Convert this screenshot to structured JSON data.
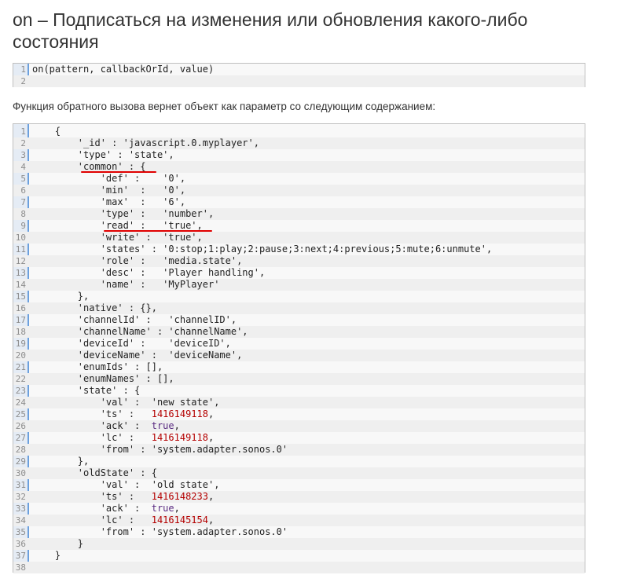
{
  "title": "on – Подписаться на изменения или обновления какого-либо состояния",
  "signature": {
    "lines": [
      [
        {
          "t": "on(pattern, callbackOrId, value)",
          "c": ""
        }
      ],
      []
    ]
  },
  "description": "Функция обратного вызова вернет объект как параметр со следующим содержанием:",
  "code": {
    "lines": [
      [
        {
          "t": "    {",
          "c": ""
        }
      ],
      [
        {
          "t": "        '_id' : 'javascript.0.myplayer',",
          "c": ""
        }
      ],
      [
        {
          "t": "        'type' : 'state',",
          "c": ""
        }
      ],
      [
        {
          "t": "        'common' : {",
          "c": ""
        }
      ],
      [
        {
          "t": "            'def' :    '0',",
          "c": ""
        }
      ],
      [
        {
          "t": "            'min'  :   '0',",
          "c": ""
        }
      ],
      [
        {
          "t": "            'max'  :   '6',",
          "c": ""
        }
      ],
      [
        {
          "t": "            'type' :   'number',",
          "c": ""
        }
      ],
      [
        {
          "t": "            'read' :   'true',",
          "c": ""
        }
      ],
      [
        {
          "t": "            'write' :  'true',",
          "c": ""
        }
      ],
      [
        {
          "t": "            'states' : '0:stop;1:play;2:pause;3:next;4:previous;5:mute;6:unmute',",
          "c": ""
        }
      ],
      [
        {
          "t": "            'role' :   'media.state',",
          "c": ""
        }
      ],
      [
        {
          "t": "            'desc' :   'Player handling',",
          "c": ""
        }
      ],
      [
        {
          "t": "            'name' :   'MyPlayer'",
          "c": ""
        }
      ],
      [
        {
          "t": "        },",
          "c": ""
        }
      ],
      [
        {
          "t": "        'native' : {},",
          "c": ""
        }
      ],
      [
        {
          "t": "        'channelId' :   'channelID',",
          "c": ""
        }
      ],
      [
        {
          "t": "        'channelName' : 'channelName',",
          "c": ""
        }
      ],
      [
        {
          "t": "        'deviceId' :    'deviceID',",
          "c": ""
        }
      ],
      [
        {
          "t": "        'deviceName' :  'deviceName',",
          "c": ""
        }
      ],
      [
        {
          "t": "        'enumIds' : [],",
          "c": ""
        }
      ],
      [
        {
          "t": "        'enumNames' : [],",
          "c": ""
        }
      ],
      [
        {
          "t": "        'state' : {",
          "c": ""
        }
      ],
      [
        {
          "t": "            'val' :  'new state',",
          "c": ""
        }
      ],
      [
        {
          "t": "            'ts' :   ",
          "c": ""
        },
        {
          "t": "1416149118",
          "c": "n"
        },
        {
          "t": ",",
          "c": ""
        }
      ],
      [
        {
          "t": "            'ack' :  ",
          "c": ""
        },
        {
          "t": "true",
          "c": "kw"
        },
        {
          "t": ",",
          "c": ""
        }
      ],
      [
        {
          "t": "            'lc' :   ",
          "c": ""
        },
        {
          "t": "1416149118",
          "c": "n"
        },
        {
          "t": ",",
          "c": ""
        }
      ],
      [
        {
          "t": "            'from' : 'system.adapter.sonos.0'",
          "c": ""
        }
      ],
      [
        {
          "t": "        },",
          "c": ""
        }
      ],
      [
        {
          "t": "        'oldState' : {",
          "c": ""
        }
      ],
      [
        {
          "t": "            'val' :  'old state',",
          "c": ""
        }
      ],
      [
        {
          "t": "            'ts' :   ",
          "c": ""
        },
        {
          "t": "1416148233",
          "c": "n"
        },
        {
          "t": ",",
          "c": ""
        }
      ],
      [
        {
          "t": "            'ack' :  ",
          "c": ""
        },
        {
          "t": "true",
          "c": "kw"
        },
        {
          "t": ",",
          "c": ""
        }
      ],
      [
        {
          "t": "            'lc' :   ",
          "c": ""
        },
        {
          "t": "1416145154",
          "c": "n"
        },
        {
          "t": ",",
          "c": ""
        }
      ],
      [
        {
          "t": "            'from' : 'system.adapter.sonos.0'",
          "c": ""
        }
      ],
      [
        {
          "t": "        }",
          "c": ""
        }
      ],
      [
        {
          "t": "    }",
          "c": ""
        }
      ],
      []
    ]
  },
  "colors": {
    "gutter_border": "#6ca0dd",
    "number": "#b40000",
    "keyword": "#5b2c82",
    "highlight_mark": "#e00000"
  }
}
